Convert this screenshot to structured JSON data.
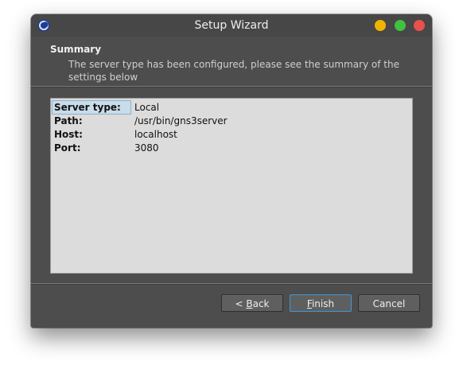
{
  "window": {
    "title": "Setup Wizard",
    "controls": {
      "minimize_color": "#f0b400",
      "maximize_color": "#3fc23f",
      "close_color": "#e8514a"
    }
  },
  "header": {
    "title": "Summary",
    "subtitle": "The server type has been configured, please see the summary of the settings below"
  },
  "summary": {
    "rows": [
      {
        "key": "Server type:",
        "value": "Local"
      },
      {
        "key": "Path:",
        "value": "/usr/bin/gns3server"
      },
      {
        "key": "Host:",
        "value": "localhost"
      },
      {
        "key": "Port:",
        "value": "3080"
      }
    ],
    "selected_row": 0
  },
  "buttons": {
    "back": {
      "prefix": "< ",
      "mnemonic": "B",
      "rest": "ack"
    },
    "finish": {
      "prefix": "",
      "mnemonic": "F",
      "rest": "inish"
    },
    "cancel": {
      "label": "Cancel"
    }
  }
}
